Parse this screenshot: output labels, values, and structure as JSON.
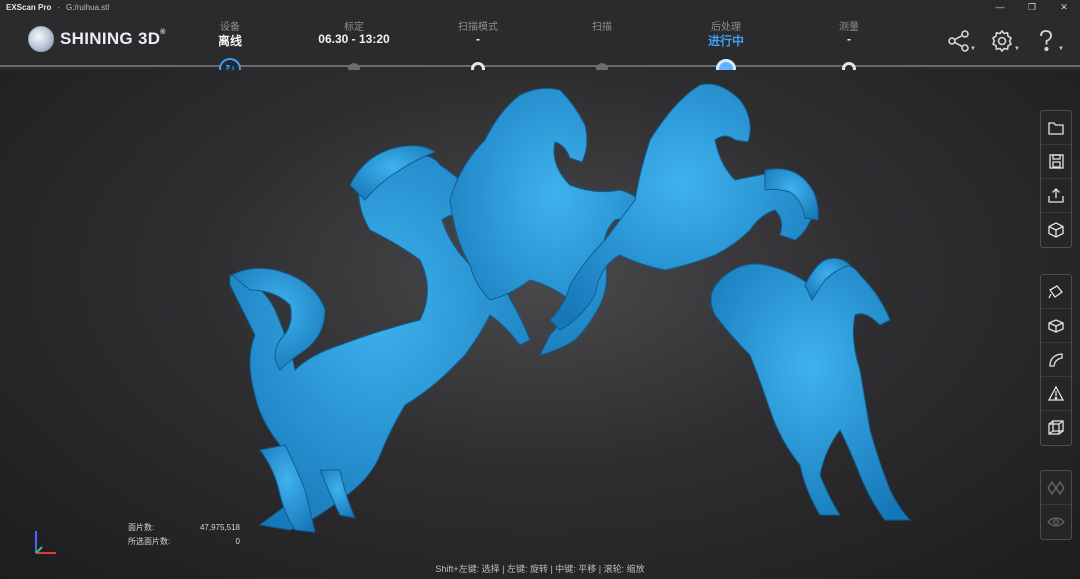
{
  "titlebar": {
    "app": "EXScan Pro",
    "separator": "-",
    "file": "G:/ruihua.stl",
    "minimize": "—",
    "restore": "❐",
    "close": "✕"
  },
  "logo": {
    "text": "SHINING 3D",
    "reg": "®"
  },
  "steps": [
    {
      "label": "设备",
      "value": "离线",
      "state": "device"
    },
    {
      "label": "标定",
      "value": "06.30 - 13:20",
      "state": "gray"
    },
    {
      "label": "扫描模式",
      "value": "-",
      "state": "ring"
    },
    {
      "label": "扫描",
      "value": "",
      "state": "gray"
    },
    {
      "label": "后处理",
      "value": "进行中",
      "state": "active"
    },
    {
      "label": "测量",
      "value": "-",
      "state": "ring"
    }
  ],
  "header_icons": [
    "share-icon",
    "settings-icon",
    "help-icon"
  ],
  "toolbar": {
    "group1": [
      "folder-open-icon",
      "save-icon",
      "export-icon",
      "cube-icon"
    ],
    "group2": [
      "fill-holes-icon",
      "box-icon",
      "curve-icon",
      "triangle-warning-icon",
      "wireframe-cube-icon"
    ],
    "group3": [
      "mesh-icon",
      "eye-icon"
    ]
  },
  "stats": {
    "triangles_label": "面片数:",
    "triangles_value": "47,975,518",
    "selected_label": "所选面片数:",
    "selected_value": "0"
  },
  "hint": "Shift+左键: 选择 | 左键: 旋转 | 中键: 平移 | 滚轮: 缩放",
  "colors": {
    "accent": "#3f9ff0",
    "model": "#1e8fd0"
  }
}
